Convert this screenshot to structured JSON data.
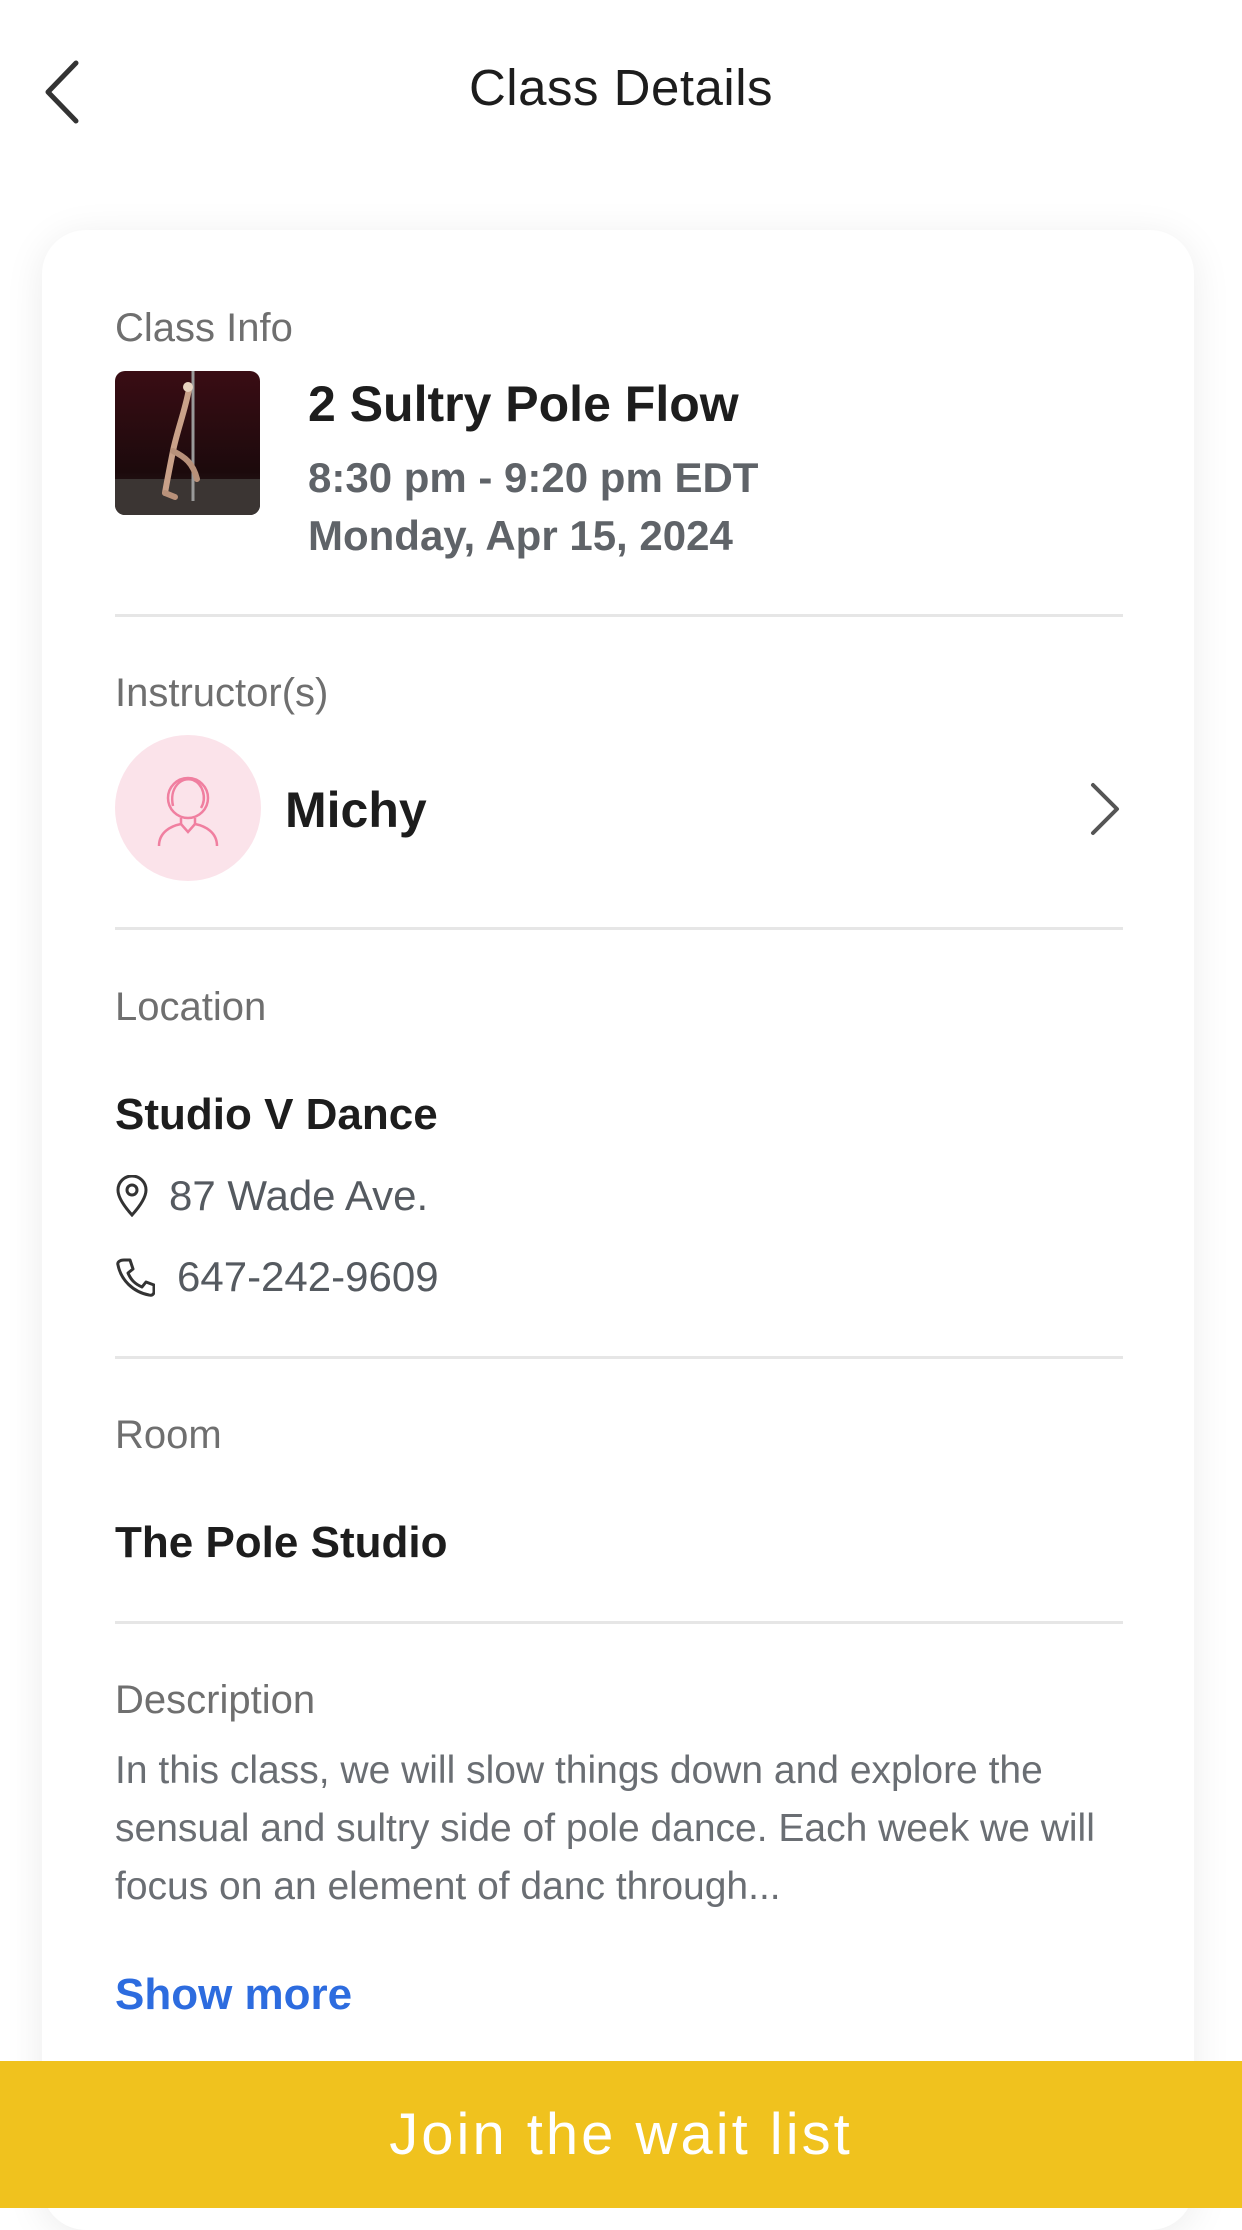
{
  "header": {
    "title": "Class Details",
    "back_icon": "chevron-left-icon"
  },
  "class_info": {
    "label": "Class Info",
    "name": "2 Sultry Pole Flow",
    "time": "8:30 pm - 9:20 pm EDT",
    "date": "Monday, Apr 15, 2024"
  },
  "instructor": {
    "label": "Instructor(s)",
    "name": "Michy",
    "avatar_icon": "person-avatar-icon"
  },
  "location": {
    "label": "Location",
    "studio": "Studio V Dance",
    "address": "87 Wade Ave.",
    "phone": "647-242-9609"
  },
  "room": {
    "label": "Room",
    "name": "The Pole Studio"
  },
  "description": {
    "label": "Description",
    "text": "In this class, we will slow things down and explore the sensual and sultry side of pole dance.  Each week we will focus on an element of danc through...",
    "show_more": "Show more"
  },
  "footer": {
    "join_label": "Join the wait list"
  },
  "colors": {
    "accent": "#f0c21e",
    "link": "#2d6cdf",
    "avatar_bg": "#fbe3ea",
    "avatar_line": "#f07fa0"
  }
}
